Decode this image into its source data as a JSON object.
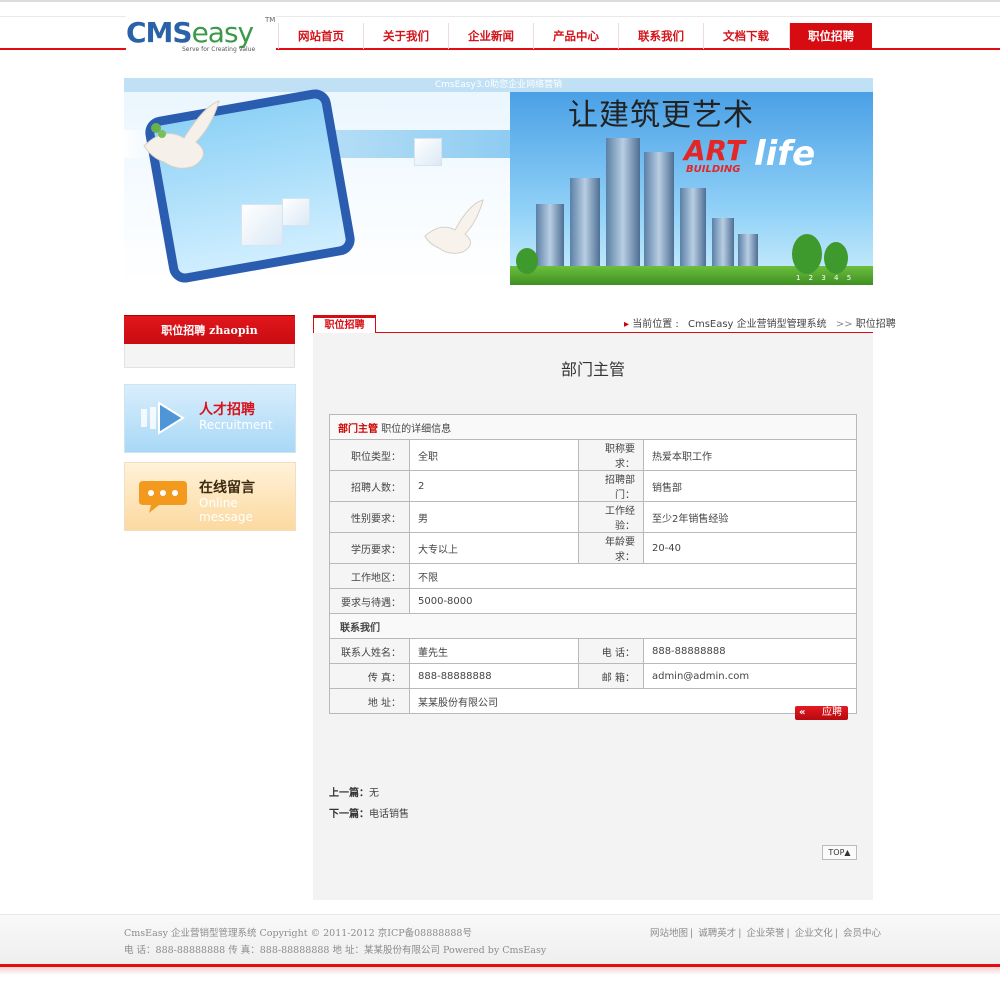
{
  "header": {
    "logo": {
      "cms": "CMS",
      "easy": "easy",
      "tm": "TM",
      "tagline": "Serve for Creating Value"
    },
    "nav": [
      "网站首页",
      "关于我们",
      "企业新闻",
      "产品中心",
      "联系我们",
      "文档下载",
      "职位招聘"
    ],
    "active_nav": "职位招聘"
  },
  "banner": {
    "caption": "CmsEasy3.0助您企业网络营销",
    "slogan": "让建筑更艺术",
    "art": "ART",
    "life": "life",
    "building": "BUILDING",
    "pager": "1 2 3 4 5"
  },
  "sidebar": {
    "title": "职位招聘 zhaopin",
    "recruit": {
      "cn": "人才招聘",
      "en": "Recruitment"
    },
    "message": {
      "cn": "在线留言",
      "en": "Online message"
    }
  },
  "main": {
    "tab": "职位招聘",
    "breadcrumb": {
      "prefix": "当前位置 :",
      "site": "CmsEasy 企业营销型管理系统",
      "sep": ">>",
      "current": "职位招聘"
    },
    "title": "部门主管",
    "table": {
      "caption_strong": "部门主管",
      "caption_rest": "职位的详细信息",
      "rows": [
        {
          "l1": "职位类型：",
          "v1": "全职",
          "l2": "职称要求：",
          "v2": "热爱本职工作"
        },
        {
          "l1": "招聘人数：",
          "v1": "2",
          "l2": "招聘部门：",
          "v2": "销售部"
        },
        {
          "l1": "性别要求：",
          "v1": "男",
          "l2": "工作经验：",
          "v2": "至少2年销售经验"
        },
        {
          "l1": "学历要求：",
          "v1": "大专以上",
          "l2": "年龄要求：",
          "v2": "20-40"
        }
      ],
      "region_label": "工作地区：",
      "region": "不限",
      "salary_label": "要求与待遇：",
      "salary": "5000-8000",
      "contact_head": "联系我们",
      "contact_rows": [
        {
          "l1": "联系人姓名：",
          "v1": "董先生",
          "l2": "电  话：",
          "v2": "888-88888888"
        },
        {
          "l1": "传  真：",
          "v1": "888-88888888",
          "l2": "邮  箱：",
          "v2": "admin@admin.com"
        }
      ],
      "address_label": "地  址：",
      "address": "某某股份有限公司"
    },
    "apply_icon": "«",
    "apply": "应聘",
    "prev_label": "上一篇：",
    "prev": "无",
    "next_label": "下一篇：",
    "next": "电话销售",
    "top": "TOP▲"
  },
  "footer": {
    "line1": "CmsEasy 企业营销型管理系统  Copyright © 2011-2012  京ICP备08888888号",
    "line2": "电 话：888-88888888  传 真：888-88888888  地 址：某某股份有限公司  Powered by CmsEasy",
    "links": [
      "网站地图",
      "诚聘英才",
      "企业荣誉",
      "企业文化",
      "会员中心"
    ]
  },
  "colors": {
    "brand_red": "#d60c12",
    "logo_blue": "#2a62a8",
    "logo_green": "#3a9a4a"
  }
}
